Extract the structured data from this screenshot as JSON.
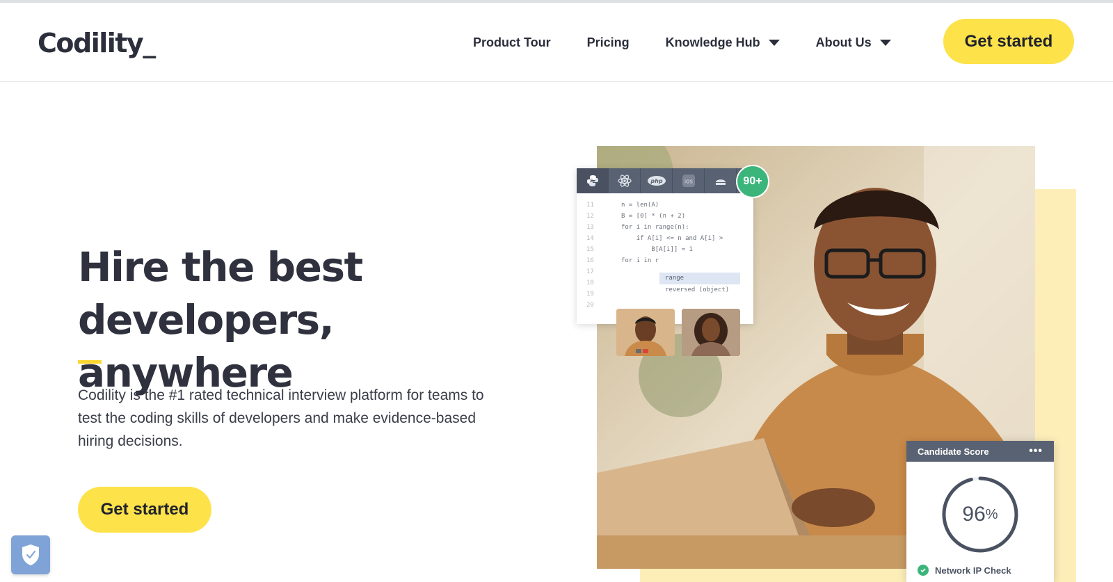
{
  "header": {
    "logo": "Codility_",
    "nav": [
      {
        "label": "Product Tour",
        "has_dropdown": false
      },
      {
        "label": "Pricing",
        "has_dropdown": false
      },
      {
        "label": "Knowledge Hub",
        "has_dropdown": true
      },
      {
        "label": "About Us",
        "has_dropdown": true
      }
    ],
    "cta_label": "Get started"
  },
  "hero": {
    "title_line1": "Hire the best",
    "title_line2": "developers, anywhere",
    "description": "Codility is the #1 rated technical interview platform for teams to test the coding skills of developers and make evidence-based hiring decisions.",
    "cta_label": "Get started"
  },
  "visual": {
    "code_tabs": [
      "python-icon",
      "react-icon",
      "php-icon",
      "ios-icon",
      "android-icon"
    ],
    "code_tab_labels": {
      "php": "php",
      "ios": "iOS"
    },
    "badge_label": "90+",
    "code_lines": [
      {
        "n": "11",
        "t": "n = len(A)"
      },
      {
        "n": "12",
        "t": "B = [0] * (n + 2)"
      },
      {
        "n": "13",
        "t": "for i in range(n):"
      },
      {
        "n": "14",
        "t": "    if A[i] <= n and A[i] >"
      },
      {
        "n": "15",
        "t": "        B[A[i]] = 1"
      },
      {
        "n": "16",
        "t": "for i in r"
      },
      {
        "n": "17",
        "t": ""
      },
      {
        "n": "18",
        "t": ""
      },
      {
        "n": "19",
        "t": ""
      },
      {
        "n": "20",
        "t": ""
      }
    ],
    "suggestions": [
      "range",
      "reversed (object)"
    ],
    "score_card": {
      "title": "Candidate Score",
      "score_number": "96",
      "score_unit": "%",
      "score_fraction": 0.96,
      "network_check": "Network IP Check"
    }
  },
  "colors": {
    "accent_yellow": "#fde24a",
    "text_dark": "#2b2e3b",
    "success_green": "#3bb57a",
    "panel_slate": "#596272"
  }
}
